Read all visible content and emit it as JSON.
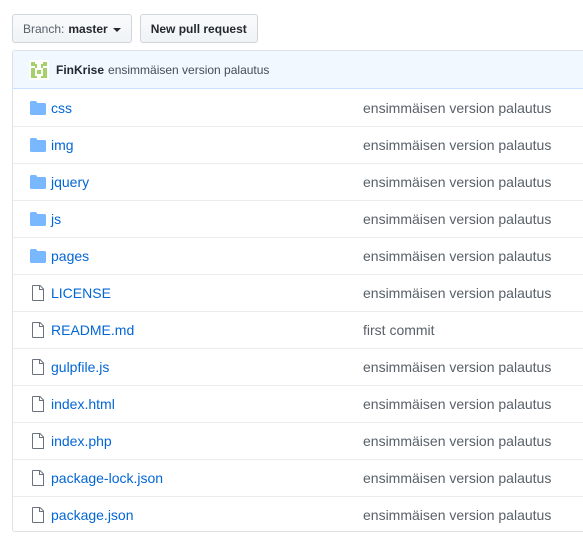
{
  "toolbar": {
    "branch_prefix": "Branch:",
    "branch_name": "master",
    "new_pull_request_label": "New pull request"
  },
  "latest_commit": {
    "author": "FinKrise",
    "message": "ensimmäisen version palautus"
  },
  "colors": {
    "link": "#0366d6",
    "folder_icon": "#79b8ff",
    "commit_bar": "#f1f8ff"
  },
  "files": [
    {
      "name": "css",
      "type": "folder",
      "icon": "folder-icon",
      "commit": "ensimmäisen version palautus"
    },
    {
      "name": "img",
      "type": "folder",
      "icon": "folder-icon",
      "commit": "ensimmäisen version palautus"
    },
    {
      "name": "jquery",
      "type": "folder",
      "icon": "folder-icon",
      "commit": "ensimmäisen version palautus"
    },
    {
      "name": "js",
      "type": "folder",
      "icon": "folder-icon",
      "commit": "ensimmäisen version palautus"
    },
    {
      "name": "pages",
      "type": "folder",
      "icon": "folder-icon",
      "commit": "ensimmäisen version palautus"
    },
    {
      "name": "LICENSE",
      "type": "file",
      "icon": "file-icon",
      "commit": "ensimmäisen version palautus"
    },
    {
      "name": "README.md",
      "type": "file",
      "icon": "file-icon",
      "commit": "first commit"
    },
    {
      "name": "gulpfile.js",
      "type": "file",
      "icon": "file-icon",
      "commit": "ensimmäisen version palautus"
    },
    {
      "name": "index.html",
      "type": "file",
      "icon": "file-icon",
      "commit": "ensimmäisen version palautus"
    },
    {
      "name": "index.php",
      "type": "file",
      "icon": "file-icon",
      "commit": "ensimmäisen version palautus"
    },
    {
      "name": "package-lock.json",
      "type": "file",
      "icon": "file-icon",
      "commit": "ensimmäisen version palautus"
    },
    {
      "name": "package.json",
      "type": "file",
      "icon": "file-icon",
      "commit": "ensimmäisen version palautus"
    }
  ]
}
